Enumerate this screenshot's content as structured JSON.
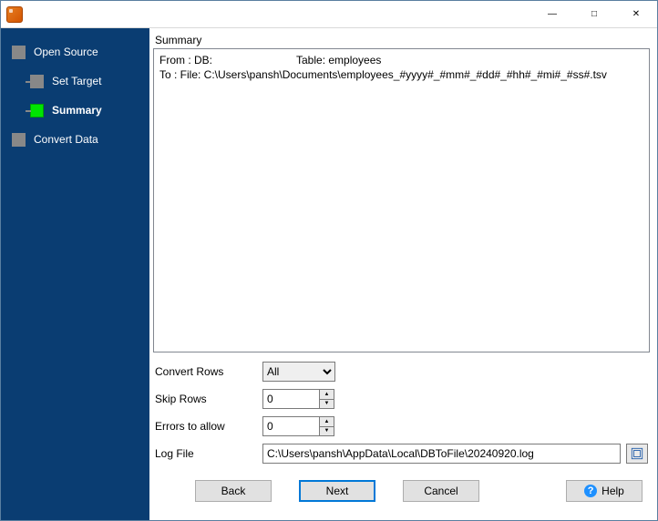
{
  "titlebar": {
    "title": ""
  },
  "nav": {
    "items": [
      {
        "label": "Open Source",
        "current": false
      },
      {
        "label": "Set Target",
        "current": false
      },
      {
        "label": "Summary",
        "current": true
      },
      {
        "label": "Convert Data",
        "current": false
      }
    ]
  },
  "summary": {
    "heading": "Summary",
    "line1_left": "From : DB:",
    "line1_right": "Table: employees",
    "line2": "To : File: C:\\Users\\pansh\\Documents\\employees_#yyyy#_#mm#_#dd#_#hh#_#mi#_#ss#.tsv"
  },
  "form": {
    "convert_rows": {
      "label": "Convert Rows",
      "value": "All"
    },
    "skip_rows": {
      "label": "Skip Rows",
      "value": "0"
    },
    "errors_allow": {
      "label": "Errors to allow",
      "value": "0"
    },
    "log_file": {
      "label": "Log File",
      "value": "C:\\Users\\pansh\\AppData\\Local\\DBToFile\\20240920.log"
    }
  },
  "buttons": {
    "back": "Back",
    "next": "Next",
    "cancel": "Cancel",
    "help": "Help"
  }
}
